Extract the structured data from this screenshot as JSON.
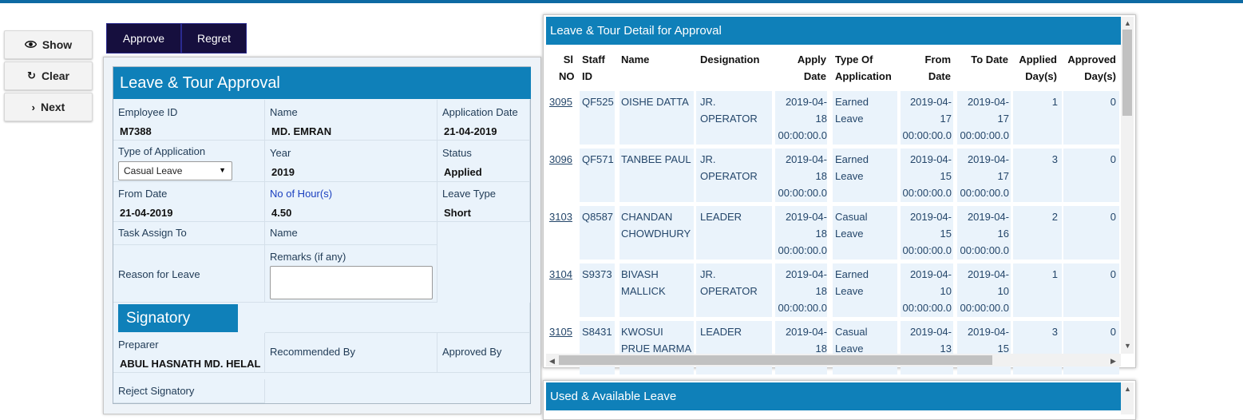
{
  "actions": {
    "show": "Show",
    "clear": "Clear",
    "next": "Next",
    "approve": "Approve",
    "regret": "Regret"
  },
  "icons": {
    "show": "eye-icon",
    "clear": "refresh-icon",
    "next": "chevron-right-icon"
  },
  "colors": {
    "header_blue": "#0f80b9",
    "action_button": "#160f3e",
    "panel_bg": "#eaf3fb"
  },
  "form": {
    "title": "Leave & Tour Approval",
    "employee_id_label": "Employee ID",
    "employee_id": "M7388",
    "name_label": "Name",
    "name": "MD. EMRAN",
    "application_date_label": "Application Date",
    "application_date": "21-04-2019",
    "type_label": "Type of Application",
    "type_value": "Casual Leave",
    "year_label": "Year",
    "year": "2019",
    "status_label": "Status",
    "status": "Applied",
    "from_date_label": "From Date",
    "from_date": "21-04-2019",
    "hours_label": "No of Hour(s)",
    "hours": "4.50",
    "leave_type_label": "Leave Type",
    "leave_type": "Short",
    "task_assign_label": "Task Assign To",
    "task_name_label": "Name",
    "reason_label": "Reason for Leave",
    "remarks_label": "Remarks (if any)",
    "remarks_value": "",
    "signatory_title": "Signatory",
    "preparer_label": "Preparer",
    "preparer": "ABUL HASNATH MD. HELAL",
    "recommended_label": "Recommended By",
    "approved_label": "Approved By",
    "reject_label": "Reject Signatory"
  },
  "table": {
    "title": "Leave & Tour Detail for Approval",
    "headers": [
      [
        "Sl",
        "NO"
      ],
      [
        "Staff",
        "ID"
      ],
      [
        "Name",
        ""
      ],
      [
        "Designation",
        ""
      ],
      [
        "Apply",
        "Date"
      ],
      [
        "Type Of",
        "Application"
      ],
      [
        "From",
        "Date"
      ],
      [
        "To Date",
        ""
      ],
      [
        "Applied",
        "Day(s)"
      ],
      [
        "Approved",
        "Day(s)"
      ]
    ],
    "rows": [
      {
        "no": "3095",
        "staff": "QF525",
        "name": [
          "OISHE DATTA"
        ],
        "designation": [
          "JR.",
          "OPERATOR"
        ],
        "apply": [
          "2019-04-",
          "18",
          "00:00:00.0"
        ],
        "type": [
          "Earned",
          "Leave"
        ],
        "from": [
          "2019-04-",
          "17",
          "00:00:00.0"
        ],
        "to": [
          "2019-04-",
          "17",
          "00:00:00.0"
        ],
        "applied": "1",
        "approved": "0"
      },
      {
        "no": "3096",
        "staff": "QF571",
        "name": [
          "TANBEE PAUL"
        ],
        "designation": [
          "JR.",
          "OPERATOR"
        ],
        "apply": [
          "2019-04-",
          "18",
          "00:00:00.0"
        ],
        "type": [
          "Earned",
          "Leave"
        ],
        "from": [
          "2019-04-",
          "15",
          "00:00:00.0"
        ],
        "to": [
          "2019-04-",
          "17",
          "00:00:00.0"
        ],
        "applied": "3",
        "approved": "0"
      },
      {
        "no": "3103",
        "staff": "Q8587",
        "name": [
          "CHANDAN",
          "CHOWDHURY"
        ],
        "designation": [
          "LEADER"
        ],
        "apply": [
          "2019-04-",
          "18",
          "00:00:00.0"
        ],
        "type": [
          "Casual",
          "Leave"
        ],
        "from": [
          "2019-04-",
          "15",
          "00:00:00.0"
        ],
        "to": [
          "2019-04-",
          "16",
          "00:00:00.0"
        ],
        "applied": "2",
        "approved": "0"
      },
      {
        "no": "3104",
        "staff": "S9373",
        "name": [
          "BIVASH",
          "MALLICK"
        ],
        "designation": [
          "JR.",
          "OPERATOR"
        ],
        "apply": [
          "2019-04-",
          "18",
          "00:00:00.0"
        ],
        "type": [
          "Earned",
          "Leave"
        ],
        "from": [
          "2019-04-",
          "10",
          "00:00:00.0"
        ],
        "to": [
          "2019-04-",
          "10",
          "00:00:00.0"
        ],
        "applied": "1",
        "approved": "0"
      },
      {
        "no": "3105",
        "staff": "S8431",
        "name": [
          "KWOSUI",
          "PRUE MARMA"
        ],
        "designation": [
          "LEADER"
        ],
        "apply": [
          "2019-04-",
          "18"
        ],
        "type": [
          "Casual",
          "Leave"
        ],
        "from": [
          "2019-04-",
          "13"
        ],
        "to": [
          "2019-04-",
          "15"
        ],
        "applied": "3",
        "approved": "0"
      }
    ]
  },
  "bottom": {
    "title": "Used & Available Leave"
  }
}
